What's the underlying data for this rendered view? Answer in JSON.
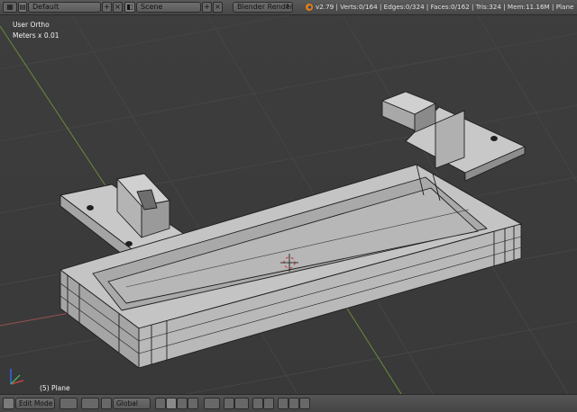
{
  "header": {
    "layout_value": "Default",
    "scene_value": "Scene",
    "render_engine": "Blender Render",
    "stats": "v2.79 | Verts:0/164 | Edges:0/324 | Faces:0/162 | Tris:324 | Mem:11.16M | Plane",
    "add_glyph": "+",
    "close_glyph": "×"
  },
  "viewport": {
    "view_label": "User Ortho",
    "units_label": "Meters x 0.01",
    "object_label": "(5) Plane"
  },
  "footer": {
    "view_menu": "View",
    "select_menu": "Select",
    "add_menu": "Add",
    "object_menu": "Object",
    "mode": "Edit Mode",
    "orientation": "Global"
  },
  "colors": {
    "grid_green": "#6a8c3a",
    "grid_red": "#9b4f4f",
    "mesh_face": "#bdbdbd",
    "mesh_edge": "#1e1e1e"
  }
}
